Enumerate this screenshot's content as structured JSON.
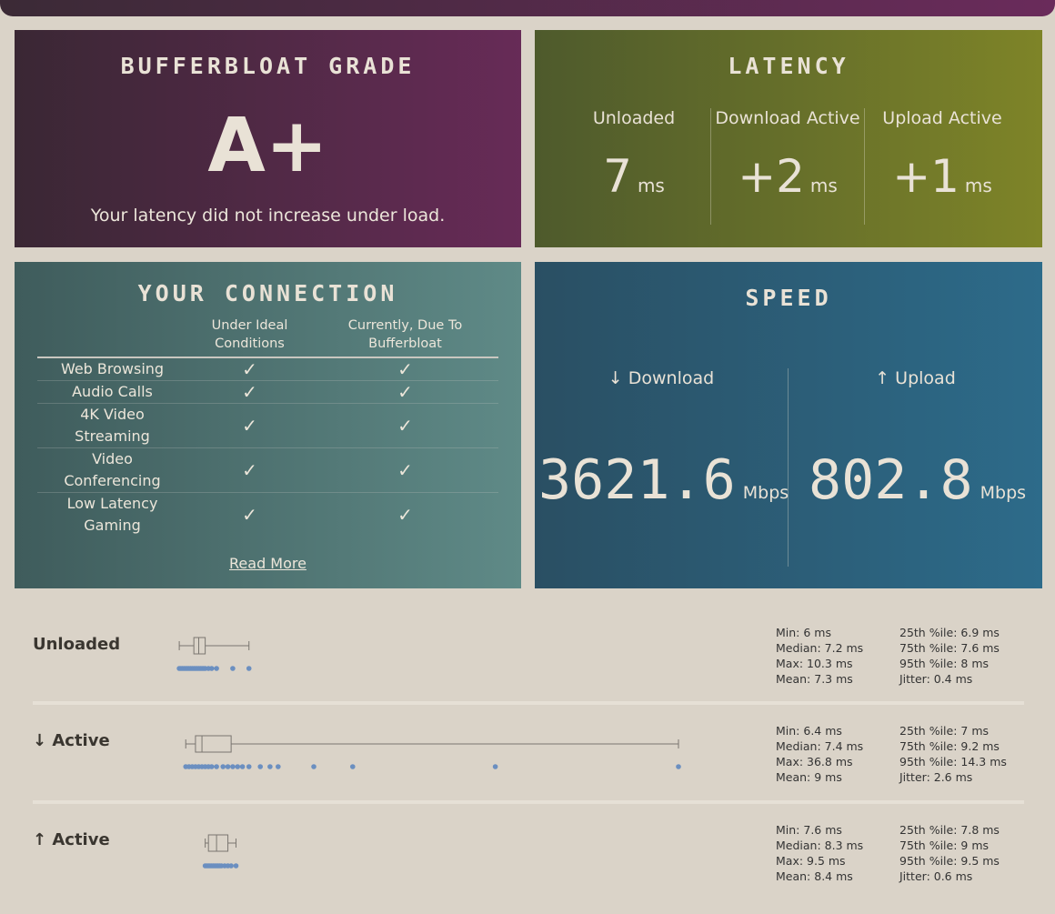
{
  "grade": {
    "title": "BUFFERBLOAT GRADE",
    "value": "A+",
    "description": "Your latency did not increase under load."
  },
  "latency": {
    "title": "LATENCY",
    "cols": [
      {
        "label": "Unloaded",
        "value": "7",
        "unit": "ms"
      },
      {
        "label": "Download Active",
        "value": "+2",
        "unit": "ms"
      },
      {
        "label": "Upload Active",
        "value": "+1",
        "unit": "ms"
      }
    ]
  },
  "connection": {
    "title": "YOUR CONNECTION",
    "col_ideal_line1": "Under Ideal",
    "col_ideal_line2": "Conditions",
    "col_current_line1": "Currently, Due To",
    "col_current_line2": "Bufferbloat",
    "rows": [
      {
        "label1": "Web Browsing",
        "label2": "",
        "ideal": "✓",
        "current": "✓"
      },
      {
        "label1": "Audio Calls",
        "label2": "",
        "ideal": "✓",
        "current": "✓"
      },
      {
        "label1": "4K Video",
        "label2": "Streaming",
        "ideal": "✓",
        "current": "✓"
      },
      {
        "label1": "Video",
        "label2": "Conferencing",
        "ideal": "✓",
        "current": "✓"
      },
      {
        "label1": "Low Latency",
        "label2": "Gaming",
        "ideal": "✓",
        "current": "✓"
      }
    ],
    "read_more": "Read More"
  },
  "speed": {
    "title": "SPEED",
    "download": {
      "label": "↓ Download",
      "value": "3621.6",
      "unit": "Mbps"
    },
    "upload": {
      "label": "↑ Upload",
      "value": "802.8",
      "unit": "Mbps"
    }
  },
  "stats": {
    "axis_range_ms": [
      1,
      36.8
    ],
    "colors": {
      "points": "#6b8fc0",
      "box": "#7a7670"
    },
    "sections": [
      {
        "label": "Unloaded",
        "box": {
          "min": 6,
          "q1": 6.9,
          "median": 7.2,
          "q3": 7.6,
          "max": 10.3
        },
        "points": [
          6,
          6.1,
          6.2,
          6.3,
          6.4,
          6.5,
          6.6,
          6.7,
          6.8,
          6.9,
          7.0,
          7.1,
          7.2,
          7.3,
          7.4,
          7.5,
          7.6,
          7.8,
          8.0,
          8.3,
          9.3,
          10.3
        ],
        "lines": {
          "min": "Min: 6 ms",
          "median": "Median: 7.2 ms",
          "max": "Max: 10.3 ms",
          "mean": "Mean: 7.3 ms",
          "p25": "25th %ile: 6.9 ms",
          "p75": "75th %ile: 7.6 ms",
          "p95": "95th %ile: 8 ms",
          "jitter": "Jitter: 0.4 ms"
        }
      },
      {
        "label": "↓ Active",
        "box": {
          "min": 6.4,
          "q1": 7,
          "median": 7.4,
          "q3": 9.2,
          "max": 36.8
        },
        "points": [
          6.4,
          6.6,
          6.8,
          7.0,
          7.2,
          7.4,
          7.6,
          7.8,
          8.0,
          8.3,
          8.7,
          9.0,
          9.3,
          9.6,
          9.9,
          10.3,
          11.0,
          11.6,
          12.1,
          14.3,
          16.7,
          25.5,
          36.8
        ],
        "lines": {
          "min": "Min: 6.4 ms",
          "median": "Median: 7.4 ms",
          "max": "Max: 36.8 ms",
          "mean": "Mean: 9 ms",
          "p25": "25th %ile: 7 ms",
          "p75": "75th %ile: 9.2 ms",
          "p95": "95th %ile: 14.3 ms",
          "jitter": "Jitter: 2.6 ms"
        }
      },
      {
        "label": "↑ Active",
        "box": {
          "min": 7.6,
          "q1": 7.8,
          "median": 8.3,
          "q3": 9,
          "max": 9.5
        },
        "points": [
          7.6,
          7.7,
          7.8,
          7.9,
          8.0,
          8.1,
          8.2,
          8.3,
          8.4,
          8.5,
          8.6,
          8.8,
          9.0,
          9.2,
          9.5
        ],
        "lines": {
          "min": "Min: 7.6 ms",
          "median": "Median: 8.3 ms",
          "max": "Max: 9.5 ms",
          "mean": "Mean: 8.4 ms",
          "p25": "25th %ile: 7.8 ms",
          "p75": "75th %ile: 9 ms",
          "p95": "95th %ile: 9.5 ms",
          "jitter": "Jitter: 0.6 ms"
        }
      }
    ]
  }
}
